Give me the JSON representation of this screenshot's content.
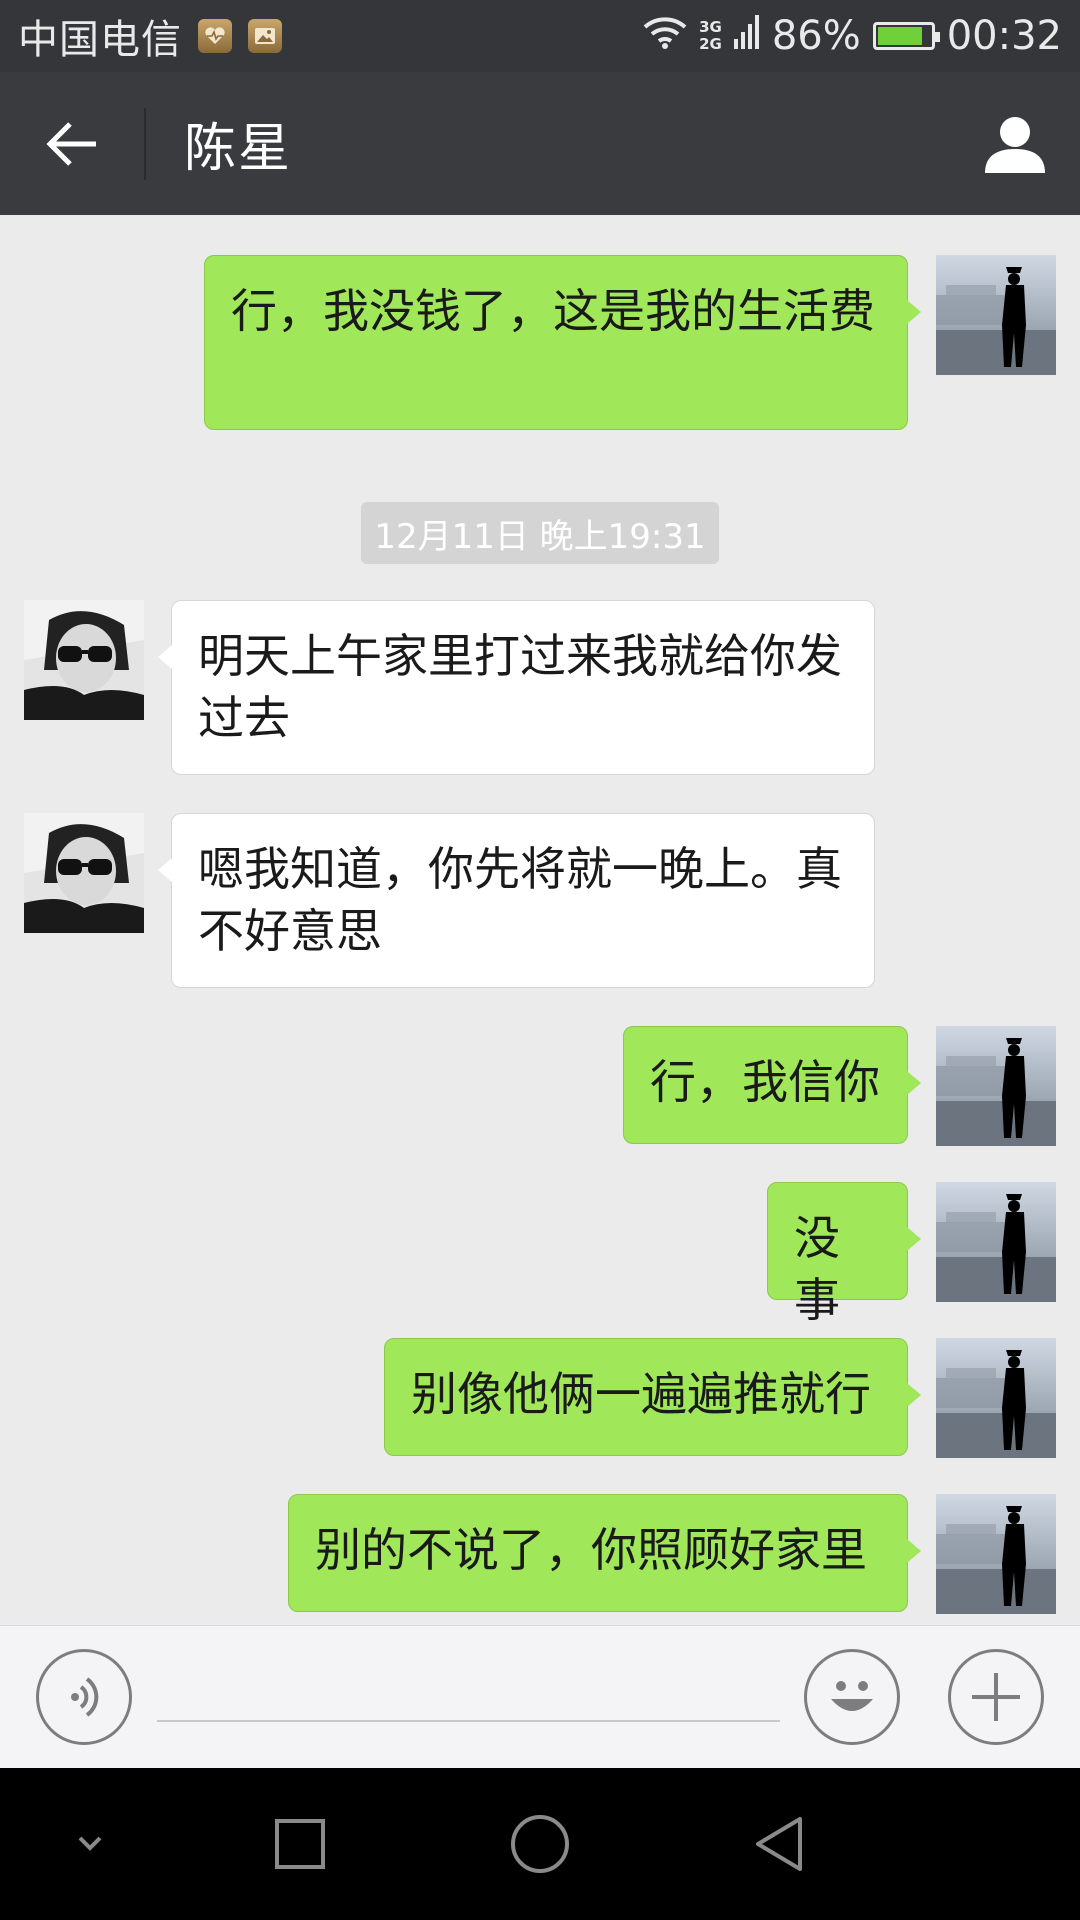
{
  "status_bar": {
    "carrier": "中国电信",
    "net_top": "3G",
    "net_bottom": "2G",
    "battery_percent": "86%",
    "battery_level": 0.86,
    "time": "00:32"
  },
  "header": {
    "title": "陈星"
  },
  "messages": [
    {
      "from": "me",
      "text": "行，我没钱了，这是我的生活费"
    },
    {
      "type": "timestamp",
      "text": "12月11日 晚上19:31"
    },
    {
      "from": "other",
      "text": "明天上午家里打过来我就给你发过去"
    },
    {
      "from": "other",
      "text": "嗯我知道，你先将就一晚上。真不好意思"
    },
    {
      "from": "me",
      "text": "行，我信你"
    },
    {
      "from": "me",
      "text": "没事"
    },
    {
      "from": "me",
      "text": "别像他俩一遍遍推就行"
    },
    {
      "from": "me",
      "text": "别的不说了，你照顾好家里"
    }
  ],
  "input_bar": {
    "placeholder": "",
    "icons": [
      "voice-icon",
      "emoji-icon",
      "plus-icon"
    ]
  },
  "nav_bar": {
    "icons": [
      "collapse-down-icon",
      "recents-square-icon",
      "home-circle-icon",
      "back-triangle-icon"
    ]
  },
  "colors": {
    "outgoing_bubble": "#a0e75a",
    "incoming_bubble": "#ffffff",
    "chat_background": "#ebebeb",
    "header": "#3a3b3f"
  }
}
